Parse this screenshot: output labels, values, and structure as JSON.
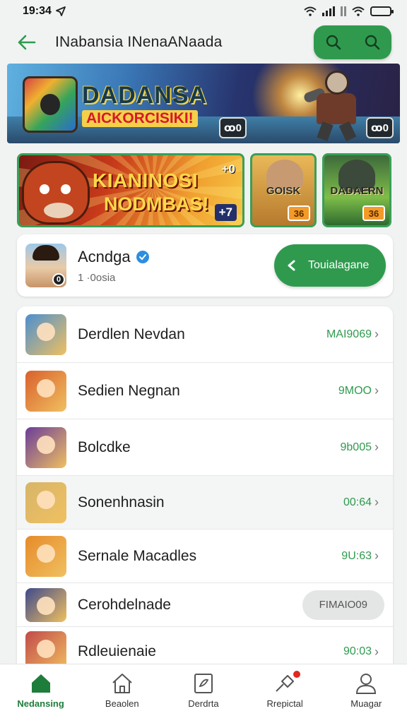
{
  "status_bar": {
    "time": "19:34"
  },
  "header": {
    "title": "INabansia INenaANaada"
  },
  "hero_banner": {
    "title": "DADANSA",
    "subtitle": "AICKORCISIKI!",
    "badge_left": "ꝏ0",
    "badge_right": "ꝏ0"
  },
  "promos": [
    {
      "line1": "KIANINOSI",
      "line2": "NODMBAS!",
      "top_tag": "+0",
      "badge": "+7"
    },
    {
      "line1": "GOISK",
      "badge": "36"
    },
    {
      "line1": "DADAERN",
      "badge": "36"
    }
  ],
  "profile": {
    "name": "Acndga",
    "subtitle": "1 ·0osia",
    "avatar_badge": "0",
    "follow_label": "Touialagane"
  },
  "list_items": [
    {
      "label": "Derdlen Nevdan",
      "meta": "MAI9069",
      "thumb_color": "#4b8fd1",
      "alt": false
    },
    {
      "label": "Sedien Negnan",
      "meta": "9MOO",
      "thumb_color": "#d9602c",
      "alt": false
    },
    {
      "label": "Bolcdke",
      "meta": "9b005",
      "thumb_color": "#6a3c9a",
      "alt": false
    },
    {
      "label": "Sonenhnasin",
      "meta": "00:64",
      "thumb_color": "#d7b56a",
      "alt": true
    },
    {
      "label": "Sernale Macadles",
      "meta": "9U:63",
      "thumb_color": "#e68b2a",
      "alt": false
    },
    {
      "label": "Cerohdelnade",
      "meta": "FIMAIO09",
      "thumb_color": "#3e4a8c",
      "alt": false,
      "style": "pill"
    },
    {
      "label": "Rdleuienaie",
      "meta": "90:03",
      "thumb_color": "#c24a4a",
      "alt": false
    }
  ],
  "bottom_nav": [
    {
      "label": "Nedansing",
      "icon": "home-filled-icon",
      "active": true
    },
    {
      "label": "Beaolen",
      "icon": "home-outline-icon",
      "active": false
    },
    {
      "label": "Derdrta",
      "icon": "document-icon",
      "active": false
    },
    {
      "label": "Rrepictal",
      "icon": "shovel-icon",
      "active": false,
      "notification": true
    },
    {
      "label": "Muagar",
      "icon": "person-icon",
      "active": false
    }
  ],
  "colors": {
    "accent": "#2f9a4e",
    "accent_dark": "#1f7d3b",
    "background": "#f1f3f2"
  }
}
